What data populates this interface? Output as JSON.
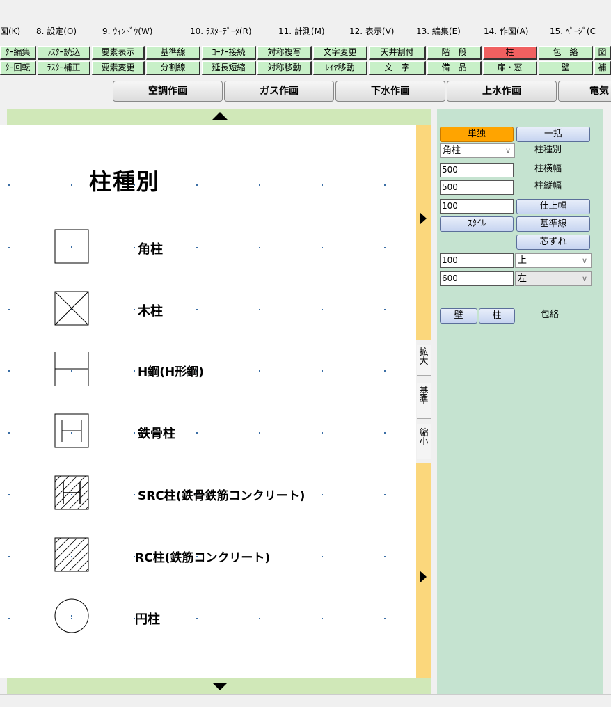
{
  "menubar": [
    "図(K)",
    "8. 設定(O)",
    "9. ｳｨﾝﾄﾞｳ(W)",
    "10. ﾗｽﾀｰﾃﾞｰﾀ(R)",
    "11. 計測(M)",
    "12. 表示(V)",
    "13. 編集(E)",
    "14. 作図(A)",
    "15. ﾍﾟｰｼﾞ(C"
  ],
  "toolbar_row1": [
    "ﾀｰ編集",
    "ﾗｽﾀｰ読込",
    "要素表示",
    "基準線",
    "ｺｰﾅｰ接続",
    "対称複写",
    "文字変更",
    "天井割付",
    "階　段",
    "柱",
    "包　絡",
    "図"
  ],
  "toolbar_row2": [
    "ﾀｰ回転",
    "ﾗｽﾀｰ補正",
    "要素変更",
    "分割線",
    "延長短縮",
    "対称移動",
    "ﾚｲﾔ移動",
    "文　字",
    "備　品",
    "扉・窓",
    "壁",
    "補"
  ],
  "tabs": [
    "空調作画",
    "ガス作画",
    "下水作画",
    "上水作画",
    "電気"
  ],
  "side_buttons": [
    "拡大",
    "基準",
    "縮小"
  ],
  "drawing": {
    "title": "柱種別",
    "items": [
      "角柱",
      "木柱",
      "H鋼(H形鋼)",
      "鉄骨柱",
      "SRC柱(鉄骨鉄筋コンクリート)",
      "RC柱(鉄筋コンクリート)",
      "円柱"
    ]
  },
  "panel": {
    "mode_single": "単独",
    "mode_batch": "一括",
    "type_select": "角柱",
    "type_label": "柱種別",
    "width_value": "500",
    "width_label": "柱横幅",
    "depth_value": "500",
    "depth_label": "柱縦幅",
    "finish_value": "100",
    "finish_button": "仕上幅",
    "style_button": "ｽﾀｲﾙ",
    "baseline_button": "基準線",
    "offset_button": "芯ずれ",
    "offset_y_value": "100",
    "offset_y_dir": "上",
    "offset_x_value": "600",
    "offset_x_dir": "左",
    "wall_button": "壁",
    "column_button": "柱",
    "envelope_label": "包絡"
  },
  "colors": {
    "panel_bg": "#c5e3d0",
    "toolbar_bg": "#c8f0c8",
    "active_tool": "#f06060",
    "mode_active": "#ffa400",
    "side_strip": "#fbd77c"
  }
}
